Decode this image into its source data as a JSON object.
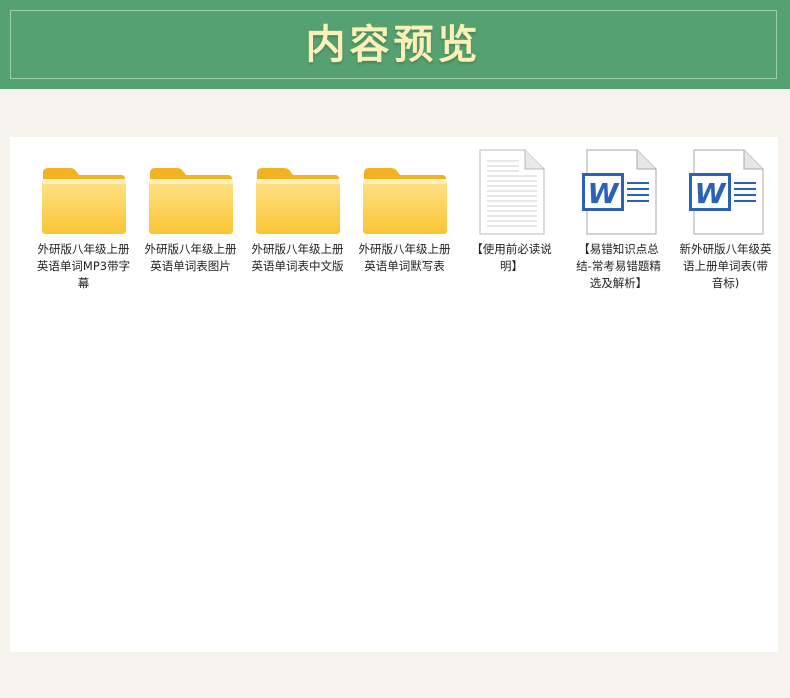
{
  "header": {
    "title": "内容预览"
  },
  "colors": {
    "banner": "#56a172",
    "title_text": "#fbf0b8",
    "folder": "#fbc93a",
    "word_blue": "#2a62b8"
  },
  "files": [
    {
      "name": "外研版八年级上册英语单词MP3带字幕",
      "type": "folder",
      "icon": "folder-icon"
    },
    {
      "name": "外研版八年级上册英语单词表图片",
      "type": "folder",
      "icon": "folder-icon"
    },
    {
      "name": "外研版八年级上册英语单词表中文版",
      "type": "folder",
      "icon": "folder-icon"
    },
    {
      "name": "外研版八年级上册英语单词默写表",
      "type": "folder",
      "icon": "folder-icon"
    },
    {
      "name": "【使用前必读说明】",
      "type": "text",
      "icon": "text-document-icon"
    },
    {
      "name": "【易错知识点总结-常考易错题精选及解析】",
      "type": "word",
      "icon": "word-document-icon"
    },
    {
      "name": "新外研版八年级英语上册单词表(带音标)",
      "type": "word",
      "icon": "word-document-icon"
    }
  ]
}
